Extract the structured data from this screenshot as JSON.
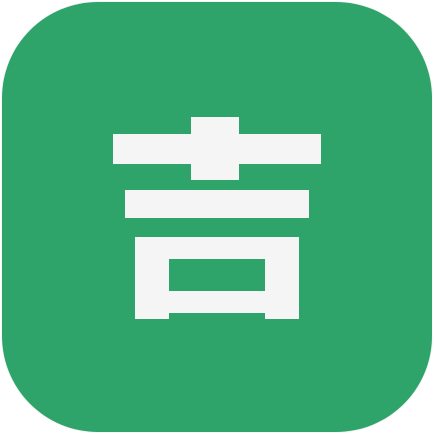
{
  "app_icon": {
    "glyph": "吉",
    "background_color": "#2ea46a",
    "glyph_color": "#f5f5f5",
    "icon_name": "ji-character-app-icon"
  }
}
